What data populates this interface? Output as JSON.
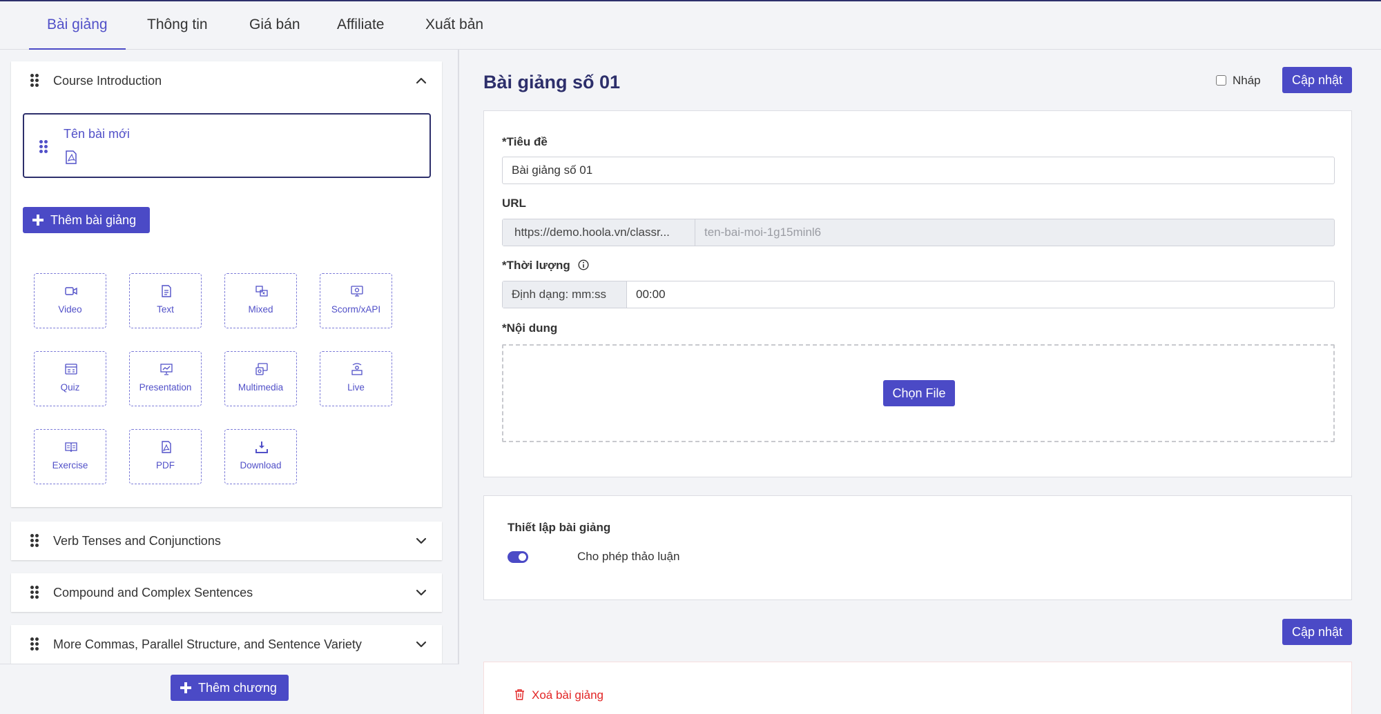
{
  "tabs": [
    {
      "label": "Bài giảng",
      "active": true
    },
    {
      "label": "Thông tin"
    },
    {
      "label": "Giá bán"
    },
    {
      "label": "Affiliate"
    },
    {
      "label": "Xuất bản"
    }
  ],
  "sidebar": {
    "open_chapter": {
      "title": "Course Introduction",
      "lesson": {
        "name": "Tên bài mới",
        "icon": "pdf-file-icon"
      },
      "add_lesson_label": "Thêm bài giảng",
      "lesson_types": [
        {
          "label": "Video",
          "icon": "video-icon"
        },
        {
          "label": "Text",
          "icon": "text-doc-icon"
        },
        {
          "label": "Mixed",
          "icon": "mixed-icon"
        },
        {
          "label": "Scorm/xAPI",
          "icon": "scorm-icon"
        },
        {
          "label": "Quiz",
          "icon": "quiz-icon"
        },
        {
          "label": "Presentation",
          "icon": "presentation-icon"
        },
        {
          "label": "Multimedia",
          "icon": "multimedia-icon"
        },
        {
          "label": "Live",
          "icon": "live-icon"
        },
        {
          "label": "Exercise",
          "icon": "exercise-icon"
        },
        {
          "label": "PDF",
          "icon": "pdf-icon"
        },
        {
          "label": "Download",
          "icon": "download-icon"
        }
      ]
    },
    "chapters": [
      {
        "title": "Verb Tenses and Conjunctions"
      },
      {
        "title": "Compound and Complex Sentences"
      },
      {
        "title": "More Commas, Parallel Structure, and Sentence Variety"
      }
    ],
    "add_chapter_label": "Thêm chương"
  },
  "editor": {
    "title": "Bài giảng số 01",
    "draft_label": "Nháp",
    "update_label": "Cập nhật",
    "title_label": "*Tiêu đề",
    "title_value": "Bài giảng số 01",
    "url_label": "URL",
    "url_prefix": "https://demo.hoola.vn/classr...",
    "url_slug": "ten-bai-moi-1g15minl6",
    "duration_label": "*Thời lượng",
    "duration_prefix": "Định dạng: mm:ss",
    "duration_value": "00:00",
    "content_label": "*Nội dung",
    "choose_file_label": "Chọn File",
    "settings_title": "Thiết lập bài giảng",
    "allow_discussion_label": "Cho phép thảo luận",
    "allow_discussion_enabled": true,
    "delete_label": "Xoá bài giảng"
  },
  "colors": {
    "primary": "#4b4ac6",
    "title": "#2d2f6b",
    "danger": "#e22424"
  }
}
